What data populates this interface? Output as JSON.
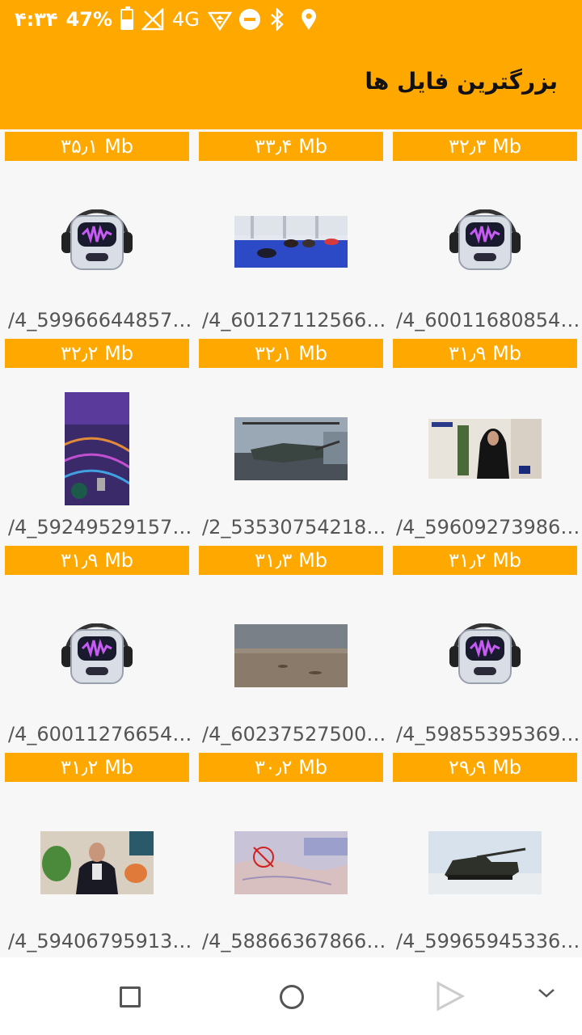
{
  "status": {
    "time": "۴:۳۴",
    "battery": "47%",
    "network": "4G"
  },
  "header": {
    "title": "بزرگترین فایل ها"
  },
  "top_sizes": [
    "۳۵٫۱ Mb",
    "۳۳٫۴ Mb",
    "۳۲٫۳ Mb"
  ],
  "rows": [
    {
      "items": [
        {
          "thumb": "robot-headphones-icon",
          "name": "/4_59966644857…"
        },
        {
          "thumb": "video-wrestling-gym",
          "name": "/4_60127112566…"
        },
        {
          "thumb": "robot-headphones-icon",
          "name": "/4_60011680854…"
        }
      ],
      "sizes": [
        "۳۲٫۲ Mb",
        "۳۲٫۱ Mb",
        "۳۱٫۹ Mb"
      ]
    },
    {
      "items": [
        {
          "thumb": "video-neon-studio",
          "name": "/4_59249529157…"
        },
        {
          "thumb": "video-helicopter",
          "name": "/2_53530754218…"
        },
        {
          "thumb": "video-interview-woman",
          "name": "/4_59609273986…"
        }
      ],
      "sizes": [
        "۳۱٫۹ Mb",
        "۳۱٫۳ Mb",
        "۳۱٫۲ Mb"
      ]
    },
    {
      "items": [
        {
          "thumb": "robot-headphones-icon",
          "name": "/4_60011276654…"
        },
        {
          "thumb": "video-desert",
          "name": "/4_60237527500…"
        },
        {
          "thumb": "robot-headphones-icon",
          "name": "/4_59855395369…"
        }
      ],
      "sizes": [
        "۳۱٫۲ Mb",
        "۳۰٫۲ Mb",
        "۲۹٫۹ Mb"
      ]
    },
    {
      "items": [
        {
          "thumb": "video-man-interview",
          "name": "/4_59406795913…"
        },
        {
          "thumb": "video-map",
          "name": "/4_58866367866…"
        },
        {
          "thumb": "video-tank",
          "name": "/4_59965945336…"
        }
      ],
      "sizes": []
    }
  ],
  "colors": {
    "accent": "#ffa800",
    "background": "#f7f7f7"
  }
}
